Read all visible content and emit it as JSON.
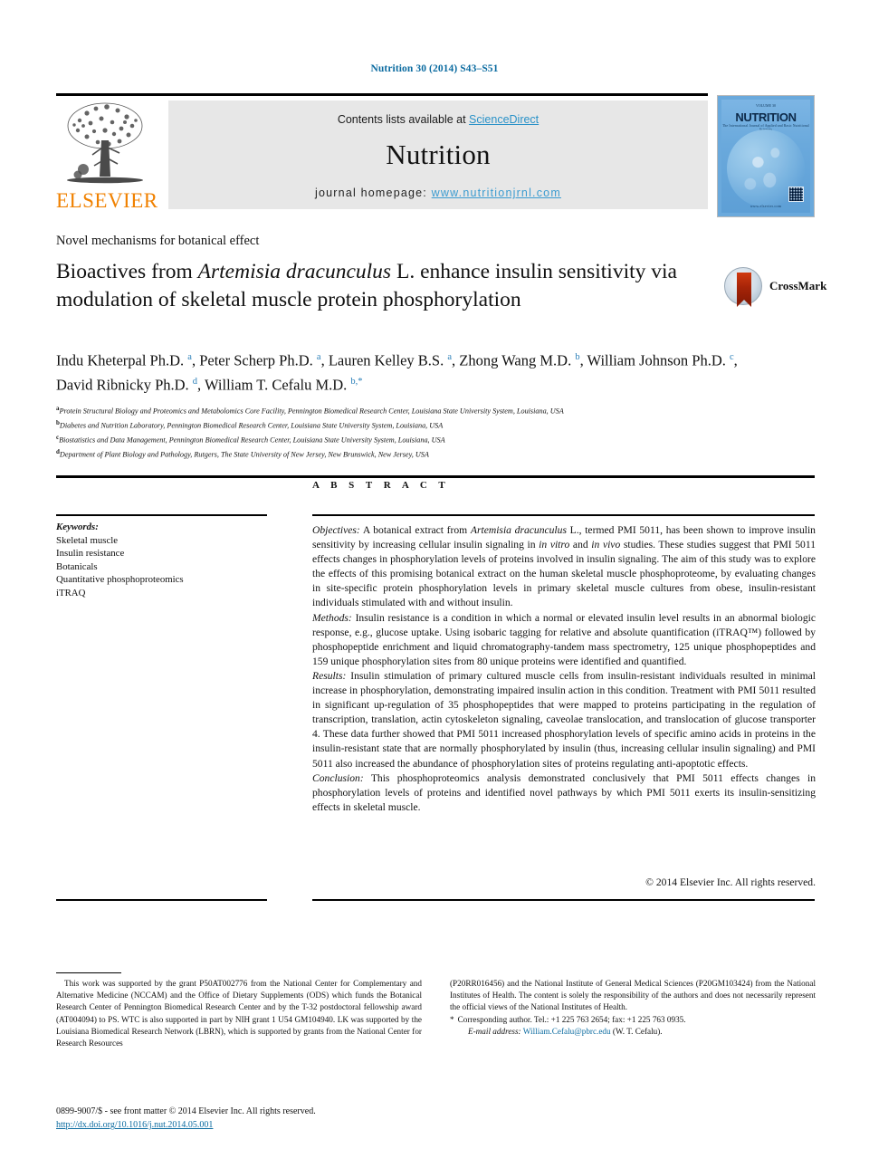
{
  "running_head": "Nutrition 30 (2014) S43–S51",
  "masthead": {
    "contents_prefix": "Contents lists available at ",
    "sciencedirect": "ScienceDirect",
    "journal_name": "Nutrition",
    "homepage_prefix": "journal homepage: ",
    "homepage_url": "www.nutritionjrnl.com",
    "publisher": "ELSEVIER",
    "publisher_logo": "elsevier-tree-logo",
    "cover": {
      "title": "NUTRITION",
      "volume": "VOLUME 30",
      "subtitle": "The International Journal of Applied and Basic Nutritional Sciences",
      "footer": "www.elsevier.com"
    }
  },
  "article": {
    "section": "Novel mechanisms for botanical effect",
    "title_part1": "Bioactives from ",
    "title_italic": "Artemisia dracunculus",
    "title_part2": " L. enhance insulin sensitivity via modulation of skeletal muscle protein phosphorylation",
    "crossmark_label": "CrossMark",
    "authors": [
      {
        "name": "Indu Kheterpal Ph.D.",
        "sup": "a",
        "sep": ", "
      },
      {
        "name": "Peter Scherp Ph.D.",
        "sup": "a",
        "sep": ", "
      },
      {
        "name": "Lauren Kelley B.S.",
        "sup": "a",
        "sep": ", "
      },
      {
        "name": "Zhong Wang M.D.",
        "sup": "b",
        "sep": ", "
      },
      {
        "name": "William Johnson Ph.D.",
        "sup": "c",
        "sep": ", "
      },
      {
        "name": "David Ribnicky Ph.D.",
        "sup": "d",
        "sep": ", "
      },
      {
        "name": "William T. Cefalu M.D.",
        "sup": "b,*",
        "sep": ""
      }
    ],
    "affiliations": [
      {
        "marker": "a",
        "text": "Protein Structural Biology and Proteomics and Metabolomics Core Facility, Pennington Biomedical Research Center, Louisiana State University System, Louisiana, USA"
      },
      {
        "marker": "b",
        "text": "Diabetes and Nutrition Laboratory, Pennington Biomedical Research Center, Louisiana State University System, Louisiana, USA"
      },
      {
        "marker": "c",
        "text": "Biostatistics and Data Management, Pennington Biomedical Research Center, Louisiana State University System, Louisiana, USA"
      },
      {
        "marker": "d",
        "text": "Department of Plant Biology and Pathology, Rutgers, The State University of New Jersey, New Brunswick, New Jersey, USA"
      }
    ]
  },
  "keywords": {
    "label": "Keywords:",
    "items": [
      "Skeletal muscle",
      "Insulin resistance",
      "Botanicals",
      "Quantitative phosphoproteomics",
      "iTRAQ"
    ]
  },
  "abstract": {
    "heading": "A B S T R A C T",
    "objectives_label": "Objectives:",
    "objectives_text": " A botanical extract from Artemisia dracunculus L., termed PMI 5011, has been shown to improve insulin sensitivity by increasing cellular insulin signaling in in vitro and in vivo studies. These studies suggest that PMI 5011 effects changes in phosphorylation levels of proteins involved in insulin signaling. The aim of this study was to explore the effects of this promising botanical extract on the human skeletal muscle phosphoproteome, by evaluating changes in site-specific protein phosphorylation levels in primary skeletal muscle cultures from obese, insulin-resistant individuals stimulated with and without insulin.",
    "methods_label": "Methods:",
    "methods_text": " Insulin resistance is a condition in which a normal or elevated insulin level results in an abnormal biologic response, e.g., glucose uptake. Using isobaric tagging for relative and absolute quantification (iTRAQ™) followed by phosphopeptide enrichment and liquid chromatography-tandem mass spectrometry, 125 unique phosphopeptides and 159 unique phosphorylation sites from 80 unique proteins were identified and quantified.",
    "results_label": "Results:",
    "results_text": " Insulin stimulation of primary cultured muscle cells from insulin-resistant individuals resulted in minimal increase in phosphorylation, demonstrating impaired insulin action in this condition. Treatment with PMI 5011 resulted in significant up-regulation of 35 phosphopeptides that were mapped to proteins participating in the regulation of transcription, translation, actin cytoskeleton signaling, caveolae translocation, and translocation of glucose transporter 4. These data further showed that PMI 5011 increased phosphorylation levels of specific amino acids in proteins in the insulin-resistant state that are normally phosphorylated by insulin (thus, increasing cellular insulin signaling) and PMI 5011 also increased the abundance of phosphorylation sites of proteins regulating anti-apoptotic effects.",
    "conclusion_label": "Conclusion:",
    "conclusion_text": " This phosphoproteomics analysis demonstrated conclusively that PMI 5011 effects changes in phosphorylation levels of proteins and identified novel pathways by which PMI 5011 exerts its insulin-sensitizing effects in skeletal muscle.",
    "copyright": "© 2014 Elsevier Inc. All rights reserved."
  },
  "footnotes": {
    "funding_left": "This work was supported by the grant P50AT002776 from the National Center for Complementary and Alternative Medicine (NCCAM) and the Office of Dietary Supplements (ODS) which funds the Botanical Research Center of Pennington Biomedical Research Center and by the T-32 postdoctoral fellowship award (AT004094) to PS. WTC is also supported in part by NIH grant 1 U54 GM104940. LK was supported by the Louisiana Biomedical Research Network (LBRN), which is supported by grants from the National Center for Research Resources",
    "funding_right": "(P20RR016456) and the National Institute of General Medical Sciences (P20GM103424) from the National Institutes of Health. The content is solely the responsibility of the authors and does not necessarily represent the official views of the National Institutes of Health.",
    "corresponding_star": "*",
    "corresponding_text": "Corresponding author. Tel.: +1 225 763 2654; fax: +1 225 763 0935.",
    "email_label": "E-mail address:",
    "email": "William.Cefalu@pbrc.edu",
    "email_owner": "(W. T. Cefalu)."
  },
  "imprint": {
    "issn": "0899-9007/$ - see front matter © 2014 Elsevier Inc. All rights reserved.",
    "doi": "http://dx.doi.org/10.1016/j.nut.2014.05.001"
  },
  "colors": {
    "link": "#0b6ba0",
    "sciencedirect": "#2a92c8",
    "elsevier_orange": "#F08100",
    "affiliation_sup": "#2a7fb8"
  }
}
